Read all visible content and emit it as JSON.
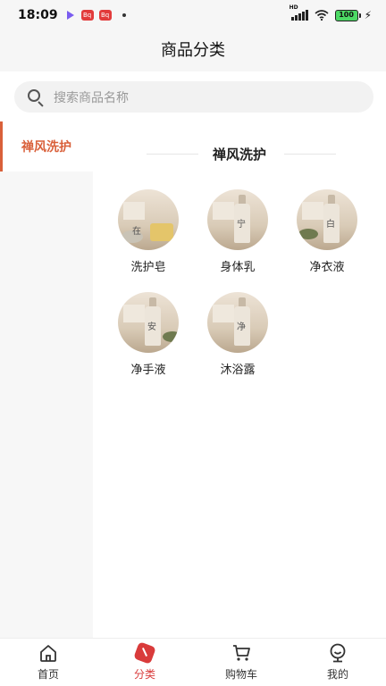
{
  "status_bar": {
    "time": "18:09",
    "app_badge_1": "Bq",
    "app_badge_2": "Bq",
    "network": "HD",
    "battery": "100"
  },
  "header": {
    "title": "商品分类"
  },
  "search": {
    "placeholder": "搜索商品名称"
  },
  "sidebar": {
    "items": [
      {
        "label": "禅风洗护",
        "active": true
      }
    ]
  },
  "main": {
    "section_title": "禅风洗护",
    "products": [
      {
        "label": "洗护皂",
        "glyph": "在"
      },
      {
        "label": "身体乳",
        "glyph": "宁"
      },
      {
        "label": "净衣液",
        "glyph": "白"
      },
      {
        "label": "净手液",
        "glyph": "安"
      },
      {
        "label": "沐浴露",
        "glyph": "净"
      }
    ]
  },
  "tabbar": {
    "tabs": [
      {
        "label": "首页",
        "icon": "home-icon",
        "active": false
      },
      {
        "label": "分类",
        "icon": "category-icon",
        "active": true
      },
      {
        "label": "购物车",
        "icon": "cart-icon",
        "active": false
      },
      {
        "label": "我的",
        "icon": "profile-icon",
        "active": false
      }
    ]
  },
  "colors": {
    "accent": "#d9603a",
    "tab_active": "#d93b3b"
  }
}
